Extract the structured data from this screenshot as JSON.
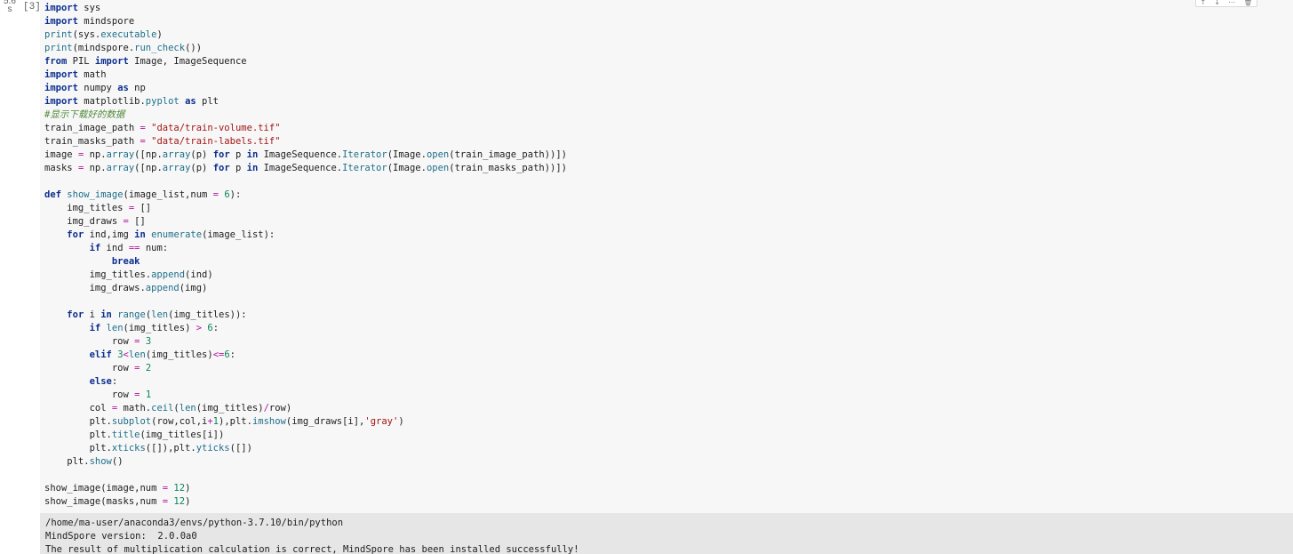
{
  "cell": {
    "exec_time": "5.6\ns",
    "exec_count": "[3]",
    "toolbar_icons": [
      "arrow-up-icon",
      "arrow-down-icon",
      "more-icon",
      "delete-icon"
    ]
  },
  "code": {
    "lines": [
      "import sys",
      "import mindspore",
      "print(sys.executable)",
      "print(mindspore.run_check())",
      "from PIL import Image, ImageSequence",
      "import math",
      "import numpy as np",
      "import matplotlib.pyplot as plt",
      "#显示下载好的数据",
      "train_image_path = \"data/train-volume.tif\"",
      "train_masks_path = \"data/train-labels.tif\"",
      "image = np.array([np.array(p) for p in ImageSequence.Iterator(Image.open(train_image_path))])",
      "masks = np.array([np.array(p) for p in ImageSequence.Iterator(Image.open(train_masks_path))])",
      "",
      "def show_image(image_list,num = 6):",
      "    img_titles = []",
      "    img_draws = []",
      "    for ind,img in enumerate(image_list):",
      "        if ind == num:",
      "            break",
      "        img_titles.append(ind)",
      "        img_draws.append(img)",
      "",
      "    for i in range(len(img_titles)):",
      "        if len(img_titles) > 6:",
      "            row = 3",
      "        elif 3<len(img_titles)<=6:",
      "            row = 2",
      "        else:",
      "            row = 1",
      "        col = math.ceil(len(img_titles)/row)",
      "        plt.subplot(row,col,i+1),plt.imshow(img_draws[i],'gray')",
      "        plt.title(img_titles[i])",
      "        plt.xticks([]),plt.yticks([])",
      "    plt.show()",
      "",
      "show_image(image,num = 12)",
      "show_image(masks,num = 12)"
    ]
  },
  "output": {
    "lines": [
      "/home/ma-user/anaconda3/envs/python-3.7.10/bin/python",
      "MindSpore version:  2.0.0a0",
      "The result of multiplication calculation is correct, MindSpore has been installed successfully!"
    ]
  }
}
